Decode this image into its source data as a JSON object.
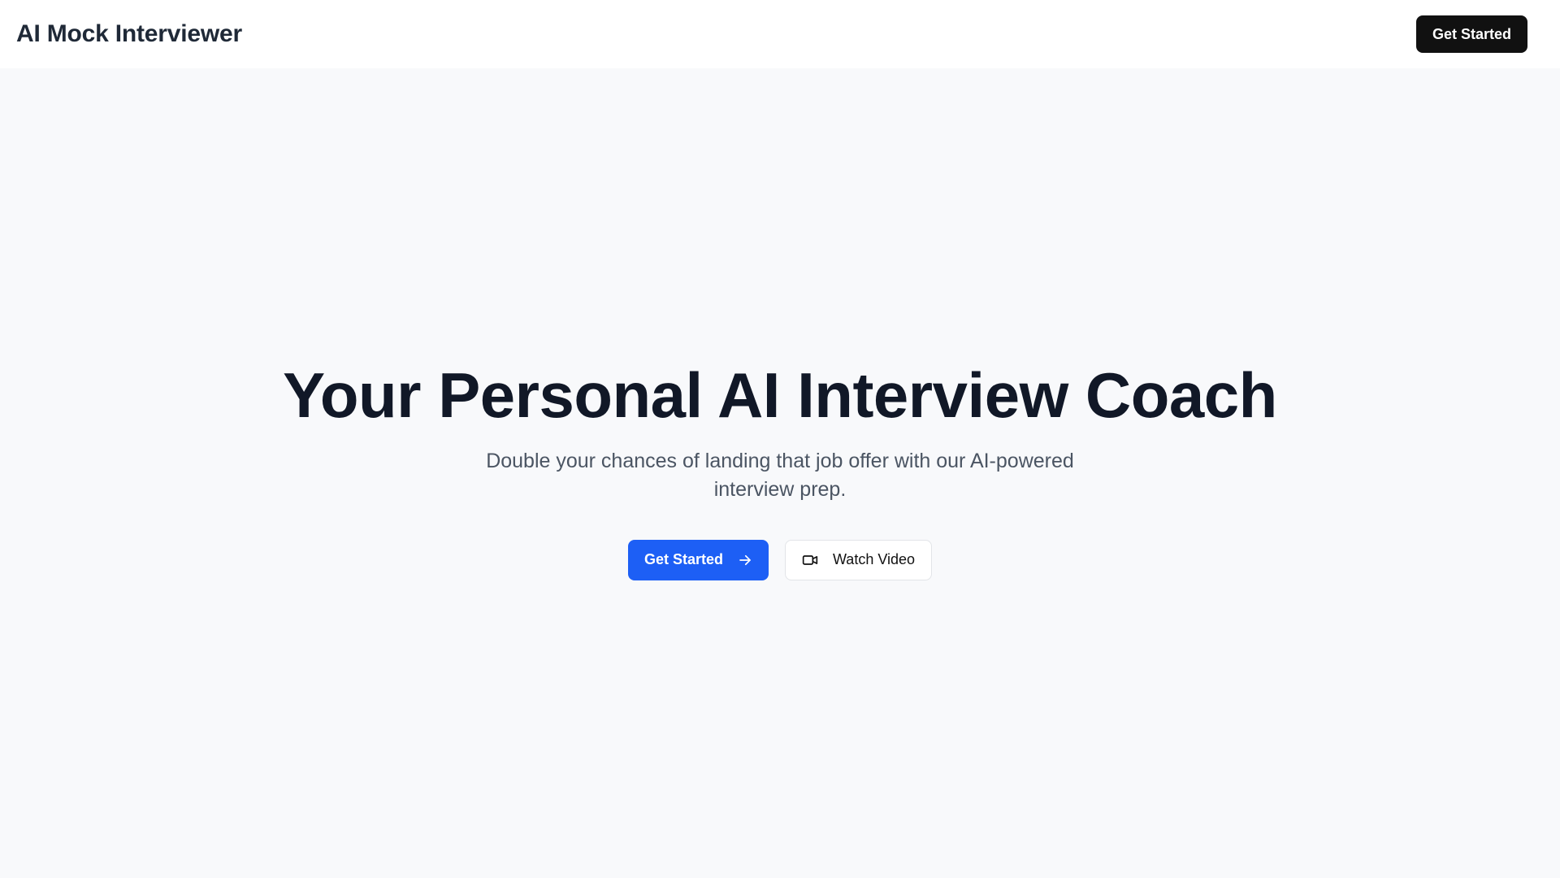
{
  "header": {
    "brand": "AI Mock Interviewer",
    "cta_label": "Get Started"
  },
  "hero": {
    "title": "Your Personal AI Interview Coach",
    "subtitle": "Double your chances of landing that job offer with our AI-powered interview prep.",
    "primary_label": "Get Started",
    "primary_icon": "arrow-right-icon",
    "secondary_label": "Watch Video",
    "secondary_icon": "video-icon"
  },
  "colors": {
    "primary": "#1d5ff5",
    "dark": "#111111",
    "background": "#f8f9fb"
  }
}
